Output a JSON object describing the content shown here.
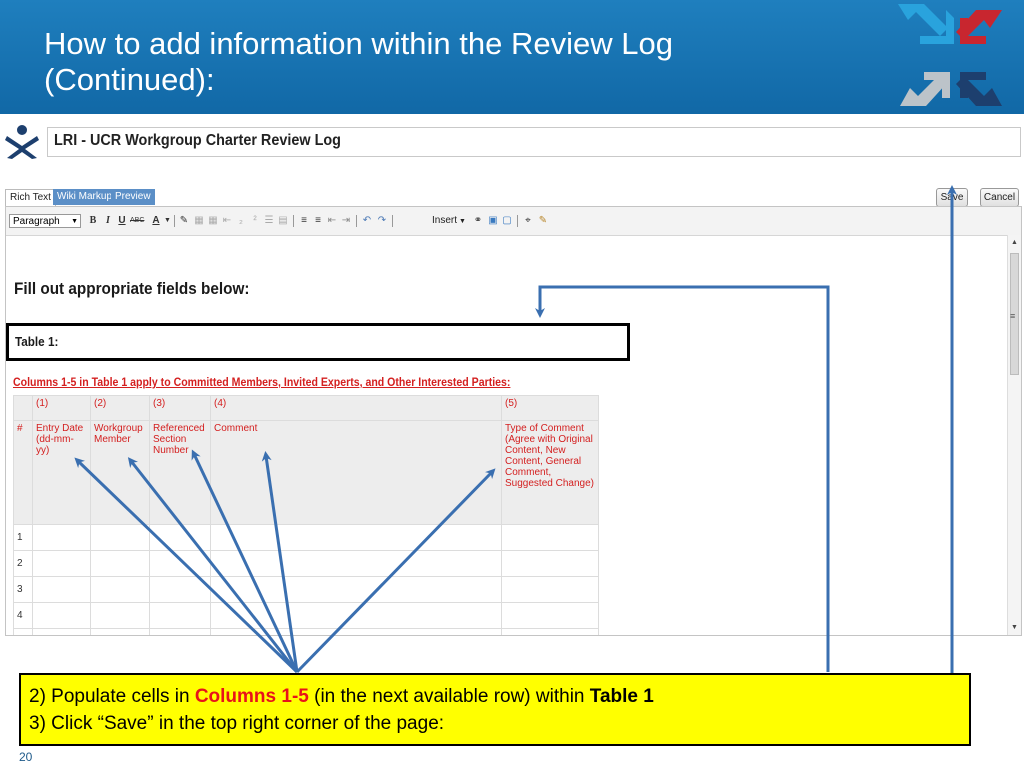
{
  "slide": {
    "title_line1": "How to add information within the Review Log",
    "title_line2": "(Continued):",
    "number": "20"
  },
  "page": {
    "title": "LRI - UCR Workgroup Charter Review Log"
  },
  "editor": {
    "tabs": [
      "Rich Text",
      "Wiki Markup",
      "Preview"
    ],
    "save_label": "Save",
    "cancel_label": "Cancel",
    "toolbar": {
      "format_select": "Paragraph",
      "bold": "B",
      "italic": "I",
      "underline": "U",
      "strike": "ABC",
      "font_color": "A",
      "insert": "Insert"
    }
  },
  "content": {
    "heading": "Fill out appropriate fields below:",
    "table_label": "Table 1:",
    "columns_note": "Columns 1-5 in Table 1 apply to Committed Members, Invited Experts, and Other Interested Parties:",
    "table": {
      "number_row": [
        "",
        "(1)",
        "(2)",
        "(3)",
        "(4)",
        "(5)"
      ],
      "header_row": [
        "#",
        "Entry Date (dd-mm-yy)",
        "Workgroup Member",
        "Referenced Section Number",
        "Comment",
        "Type of Comment (Agree with Original Content, New Content, General Comment, Suggested Change)"
      ],
      "rows": [
        "1",
        "2",
        "3",
        "4"
      ]
    }
  },
  "callout": {
    "line1_a": "2) Populate cells in ",
    "line1_b": "Columns 1-5",
    "line1_c": " (in the next available row) within ",
    "line1_d": "Table 1",
    "line2": "3) Click “Save” in the top right corner of the page:"
  },
  "colors": {
    "header_blue": "#1168a6",
    "tab_blue": "#5b8fc7",
    "note_red": "#d42020",
    "callout_yellow": "#ffff00",
    "arrow_blue": "#3a6fb0"
  }
}
